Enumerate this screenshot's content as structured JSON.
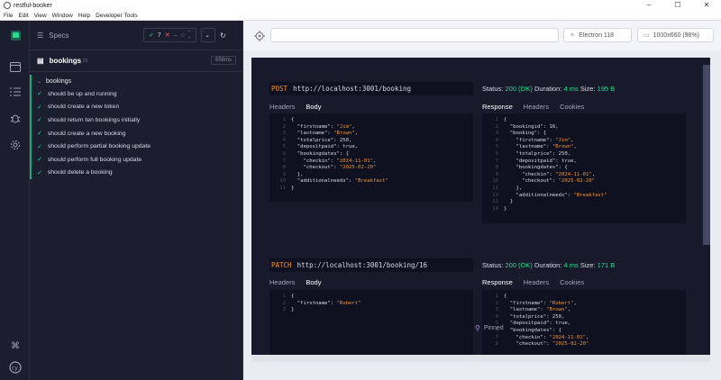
{
  "window": {
    "title": "restful-booker",
    "controls": [
      "–",
      "☐",
      "✕"
    ]
  },
  "menu": [
    "File",
    "Edit",
    "View",
    "Window",
    "Help",
    "Developer Tools"
  ],
  "specs": {
    "header_label": "Specs",
    "stats": {
      "passed": "7",
      "failed": "–",
      "pending": "--"
    },
    "spec_title": "bookings",
    "spec_sub": "ts",
    "duration": "658ms",
    "suite_title": "bookings",
    "tests": [
      "should be up and running",
      "should create a new token",
      "should return ten bookings initially",
      "should create a new booking",
      "should perform partial booking update",
      "should perform full booking update",
      "should delete a booking"
    ]
  },
  "topbar": {
    "url_placeholder": "",
    "browser": "Electron 118",
    "viewport": "1000x660 (98%)"
  },
  "requests": [
    {
      "method": "POST",
      "url": "http://localhost:3001/booking",
      "status_label": "Status:",
      "status_code": "200 (OK)",
      "duration_label": "Duration:",
      "duration": "4 ms",
      "size_label": "Size:",
      "size": "195 B",
      "req_tabs": [
        "Headers",
        "Body"
      ],
      "res_tabs": [
        "Response",
        "Headers",
        "Cookies"
      ]
    },
    {
      "method": "PATCH",
      "url": "http://localhost:3001/booking/16",
      "status_label": "Status:",
      "status_code": "200 (OK)",
      "duration_label": "Duration:",
      "duration": "4 ms",
      "size_label": "Size:",
      "size": "171 B",
      "req_tabs": [
        "Headers",
        "Body"
      ],
      "res_tabs": [
        "Response",
        "Headers",
        "Cookies"
      ]
    }
  ],
  "pinned_label": "Pinned",
  "colors": {
    "accent_green": "#2dd98f",
    "method_orange": "#f19335",
    "bg": "#1b1e2e"
  }
}
